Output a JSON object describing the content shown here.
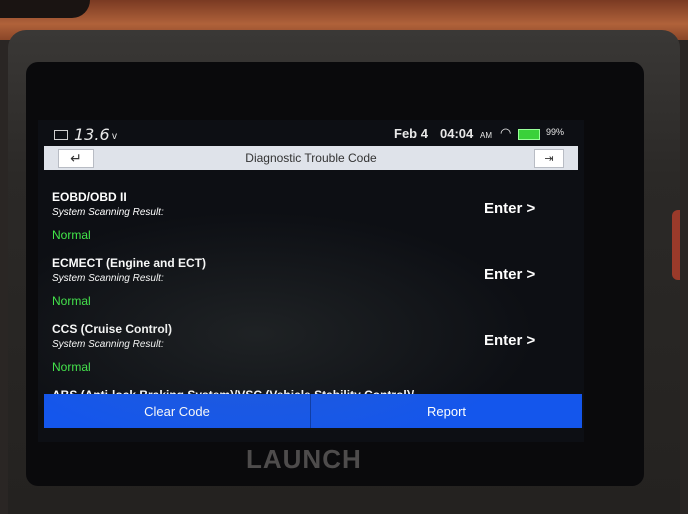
{
  "status_bar": {
    "voltage": "13.6",
    "voltage_unit": "v",
    "date": "Feb 4",
    "time": "04:04",
    "ampm": "AM",
    "battery": "99%"
  },
  "header": {
    "title": "Diagnostic Trouble Code"
  },
  "systems": [
    {
      "name": "EOBD/OBD II",
      "sub_label": "System Scanning Result:",
      "result": "Normal",
      "action": "Enter >"
    },
    {
      "name": "ECMECT (Engine and ECT)",
      "sub_label": "System Scanning Result:",
      "result": "Normal",
      "action": "Enter >"
    },
    {
      "name": "CCS (Cruise Control)",
      "sub_label": "System Scanning Result:",
      "result": "Normal",
      "action": "Enter >"
    }
  ],
  "partial_item": "ABS (Anti-lock Braking System)/VSC (Vehicle Stability Control)/",
  "buttons": {
    "clear_code": "Clear Code",
    "report": "Report"
  },
  "brand": "LAUNCH",
  "colors": {
    "normal_status": "#42e84a",
    "button_bar": "#1456ec",
    "title_bar": "#dfe3ea"
  }
}
